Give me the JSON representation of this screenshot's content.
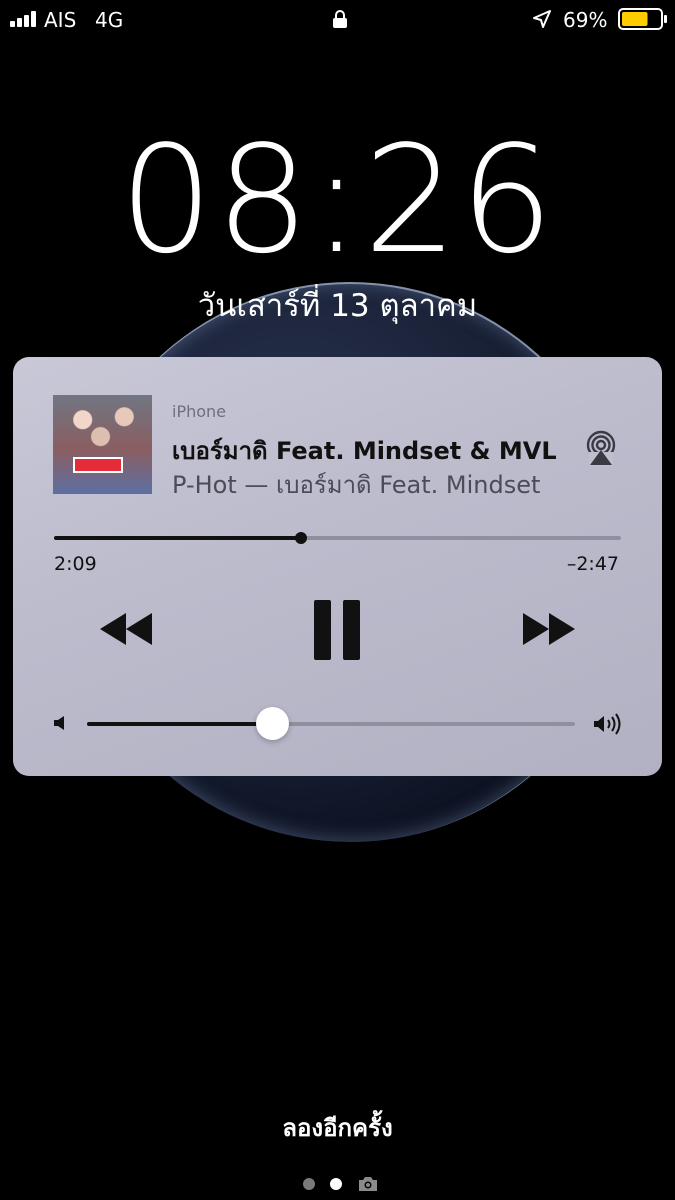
{
  "status_bar": {
    "carrier": "AIS",
    "network": "4G",
    "battery_percent": "69%",
    "battery_level": 0.69,
    "battery_color": "#FFCC00"
  },
  "lock_screen": {
    "time": "08:26",
    "date": "วันเสาร์ที่ 13 ตุลาคม"
  },
  "now_playing": {
    "source": "iPhone",
    "title": "เบอร์มาดิ Feat. Mindset & MVL",
    "subtitle": "P-Hot — เบอร์มาดิ Feat. Mindset",
    "elapsed": "2:09",
    "remaining": "–2:47",
    "progress": 0.436,
    "volume": 0.38,
    "state": "playing"
  },
  "footer": {
    "retry_text": "ลองอีกครั้ง",
    "pages": [
      "dot",
      "dot-active",
      "camera"
    ]
  },
  "icons": {
    "lock": "lock-icon",
    "location": "location-arrow-icon",
    "airplay": "airplay-icon",
    "rewind": "rewind-icon",
    "pause": "pause-icon",
    "forward": "fast-forward-icon",
    "volume_low": "speaker-low-icon",
    "volume_high": "speaker-high-icon",
    "camera": "camera-icon"
  }
}
